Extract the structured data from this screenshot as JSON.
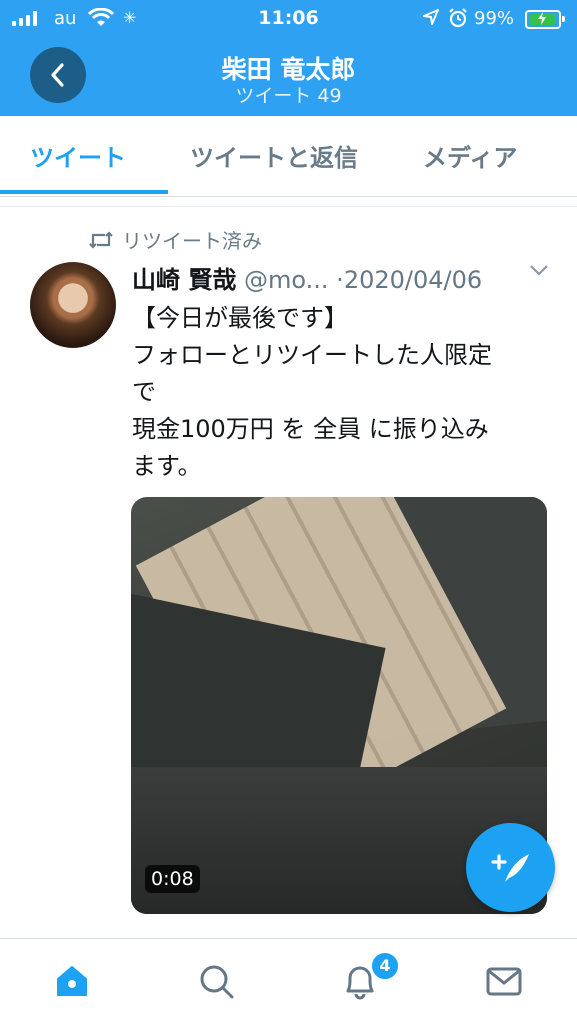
{
  "status_bar": {
    "carrier": "au",
    "time": "11:06",
    "battery_percent": "99%",
    "battery_level": 0.99,
    "icons": [
      "signal-icon",
      "wifi-icon",
      "loading-icon",
      "location-icon",
      "alarm-icon",
      "battery-charging-icon"
    ]
  },
  "header": {
    "back_icon": "chevron-left-icon",
    "title": "柴田 竜太郎",
    "subtitle": "ツイート 49"
  },
  "tabs": [
    {
      "label": "ツイート",
      "active": true
    },
    {
      "label": "ツイートと返信",
      "active": false
    },
    {
      "label": "メディア",
      "active": false
    }
  ],
  "tweet": {
    "retweet_label": "リツイート済み",
    "author_name": "山崎 賢哉",
    "handle": "@mo...",
    "separator": "·",
    "date": "2020/04/06",
    "lines": [
      "【今日が最後です】",
      "フォローとリツイートした人限定",
      "で",
      "現金100万円 を 全員 に振り込み",
      "ます。"
    ],
    "media_duration": "0:08"
  },
  "fab": {
    "icon": "compose-tweet-icon"
  },
  "bottom_nav": {
    "items": [
      "home-icon",
      "search-icon",
      "notifications-icon",
      "messages-icon"
    ],
    "notification_count": "4"
  },
  "colors": {
    "accent": "#1da1f2",
    "header_bg": "#2ea1f2",
    "back_button_bg": "#1c5e88",
    "muted_text": "#657786"
  }
}
